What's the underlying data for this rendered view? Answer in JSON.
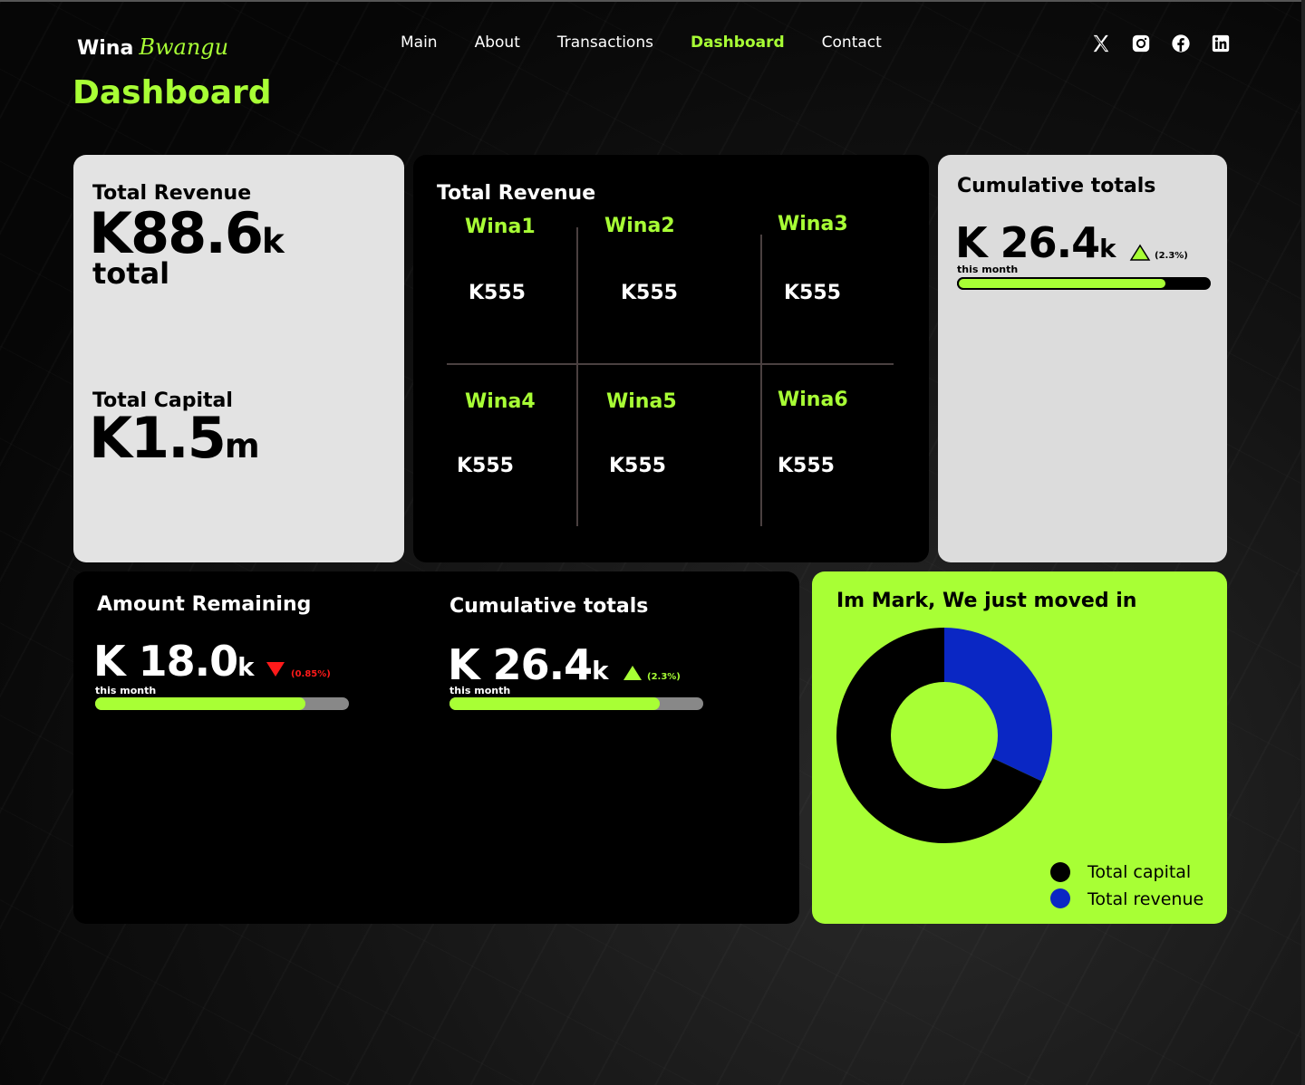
{
  "brand": {
    "first": "Wina",
    "second": "Bwangu"
  },
  "page_title": "Dashboard",
  "nav": [
    {
      "label": "Main",
      "active": false
    },
    {
      "label": "About",
      "active": false
    },
    {
      "label": "Transactions",
      "active": false
    },
    {
      "label": "Dashboard",
      "active": true
    },
    {
      "label": "Contact",
      "active": false
    }
  ],
  "socials": [
    "x-icon",
    "instagram-icon",
    "facebook-icon",
    "linkedin-icon"
  ],
  "revenue_card": {
    "revenue_label": "Total Revenue",
    "revenue_value": "K88.6",
    "revenue_unit": "k",
    "revenue_suffix": "total",
    "capital_label": "Total Capital",
    "capital_value": "K1.5",
    "capital_unit": "m"
  },
  "grid_card": {
    "title": "Total Revenue",
    "cells": [
      {
        "name": "Wina1",
        "value": "K555"
      },
      {
        "name": "Wina2",
        "value": "K555"
      },
      {
        "name": "Wina3",
        "value": "K555"
      },
      {
        "name": "Wina4",
        "value": "K555"
      },
      {
        "name": "Wina5",
        "value": "K555"
      },
      {
        "name": "Wina6",
        "value": "K555"
      }
    ]
  },
  "cumulative_card": {
    "title": "Cumulative totals",
    "value": "K 26.4",
    "unit": "k",
    "change": "(2.3%)",
    "period": "this month",
    "progress": 0.83
  },
  "bottom_card": {
    "remaining": {
      "title": "Amount Remaining",
      "value": "K 18.0",
      "unit": "k",
      "change": "(0.85%)",
      "period": "this month",
      "progress": 0.83
    },
    "cumulative": {
      "title": "Cumulative totals",
      "value": "K 26.4",
      "unit": "k",
      "change": "(2.3%)",
      "period": "this month",
      "progress": 0.83
    }
  },
  "pie_card": {
    "title": "Im Mark, We just moved in",
    "legend": [
      {
        "label": "Total capital",
        "color": "#000000"
      },
      {
        "label": "Total revenue",
        "color": "#0a27c4"
      }
    ]
  },
  "chart_data": {
    "type": "pie",
    "title": "Im Mark, We just moved in",
    "categories": [
      "Total capital",
      "Total revenue"
    ],
    "values": [
      68,
      32
    ],
    "colors": [
      "#000000",
      "#0a27c4"
    ],
    "donut": true,
    "legend": "bottom-right"
  },
  "colors": {
    "accent": "#a8ff35",
    "down": "#ff1a1a",
    "track_dark": "#888888",
    "track_light": "#000000"
  }
}
